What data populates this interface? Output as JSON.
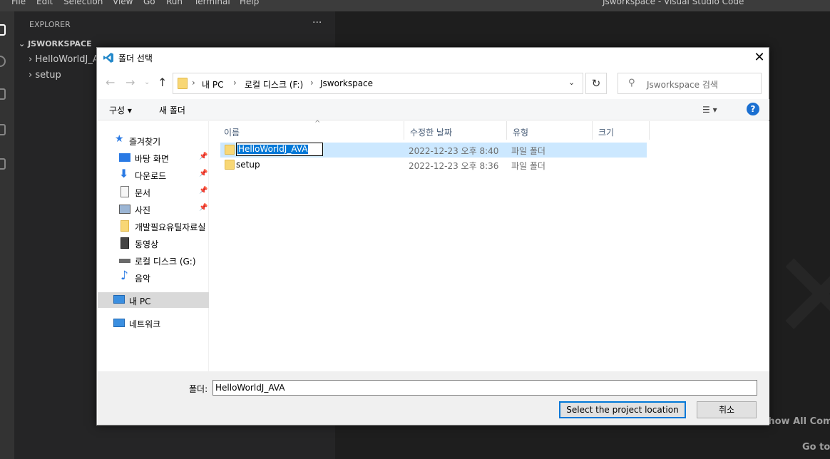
{
  "vscode": {
    "menu": [
      "File",
      "Edit",
      "Selection",
      "View",
      "Go",
      "Run",
      "Terminal",
      "Help"
    ],
    "window_title": "Jsworkspace - Visual Studio Code",
    "explorer_title": "EXPLORER",
    "more_actions": "···",
    "workspace_name": "JSWORKSPACE",
    "tree": [
      "HelloWorldJ_AVA",
      "setup"
    ],
    "hint_commands": "Show All Commands",
    "hint_goto": "Go to File"
  },
  "dialog": {
    "title": "폴더 선택",
    "close_glyph": "✕",
    "breadcrumb": [
      "내 PC",
      "로컬 디스크 (F:)",
      "Jsworkspace"
    ],
    "search_placeholder": "Jsworkspace 검색",
    "toolbar": {
      "organize": "구성 ▾",
      "new_folder": "새 폴더",
      "help": "?"
    },
    "nav": {
      "quick_access": "즐겨찾기",
      "items": [
        "바탕 화면",
        "다운로드",
        "문서",
        "사진",
        "개발필요유틸자료실",
        "동영상",
        "로컬 디스크 (G:)",
        "음악"
      ],
      "this_pc": "내 PC",
      "network": "네트워크"
    },
    "columns": [
      "이름",
      "수정한 날짜",
      "유형",
      "크기"
    ],
    "files": [
      {
        "name": "HelloWorldJ_AVA",
        "modified": "2022-12-23 오후 8:40",
        "type": "파일 폴더",
        "size": ""
      },
      {
        "name": "setup",
        "modified": "2022-12-23 오후 8:36",
        "type": "파일 폴더",
        "size": ""
      }
    ],
    "folder_label": "폴더:",
    "folder_value": "HelloWorldJ_AVA",
    "select_button": "Select the project location",
    "cancel_button": "취소"
  },
  "colors": {
    "accent": "#0078d7",
    "selection": "#cce8ff",
    "folder": "#f8d775",
    "vscode_blue": "#2489ca"
  }
}
